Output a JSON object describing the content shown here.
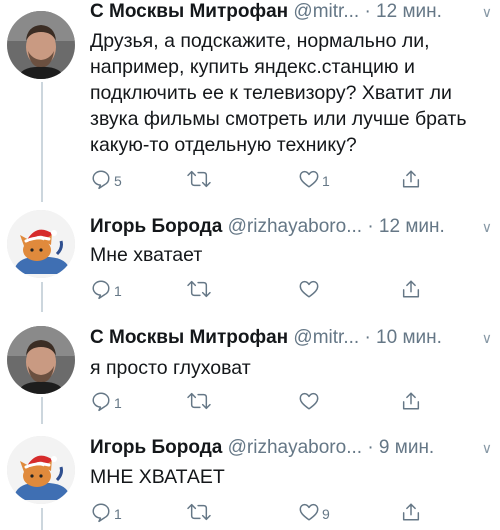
{
  "tweets": [
    {
      "author": "С Москвы Митрофан",
      "handle": "@mitr...",
      "time": "· 12 мин.",
      "text": "Друзья, а подскажите, нормально ли, например, купить яндекс.станцию и подключить ее к телевизору? Хватит ли звука фильмы смотреть или лучше брать какую-то отдельную технику?",
      "reply_count": "5",
      "retweet_count": "",
      "like_count": "1"
    },
    {
      "author": "Игорь Борода",
      "handle": "@rizhayaboro...",
      "time": "· 12 мин.",
      "text": "Мне хватает",
      "reply_count": "1",
      "retweet_count": "",
      "like_count": ""
    },
    {
      "author": "С Москвы Митрофан",
      "handle": "@mitr...",
      "time": "· 10 мин.",
      "text": "я просто глуховат",
      "reply_count": "1",
      "retweet_count": "",
      "like_count": ""
    },
    {
      "author": "Игорь Борода",
      "handle": "@rizhayaboro...",
      "time": "· 9 мин.",
      "text": "МНЕ ХВАТАЕТ",
      "reply_count": "1",
      "retweet_count": "",
      "like_count": "9"
    }
  ],
  "icons": {
    "reply": "reply-icon",
    "retweet": "retweet-icon",
    "like": "heart-icon",
    "share": "share-icon",
    "menu": "chevron-down-icon"
  },
  "colors": {
    "text": "#14171a",
    "secondary": "#657786",
    "thread_line": "#ccd6dd"
  }
}
